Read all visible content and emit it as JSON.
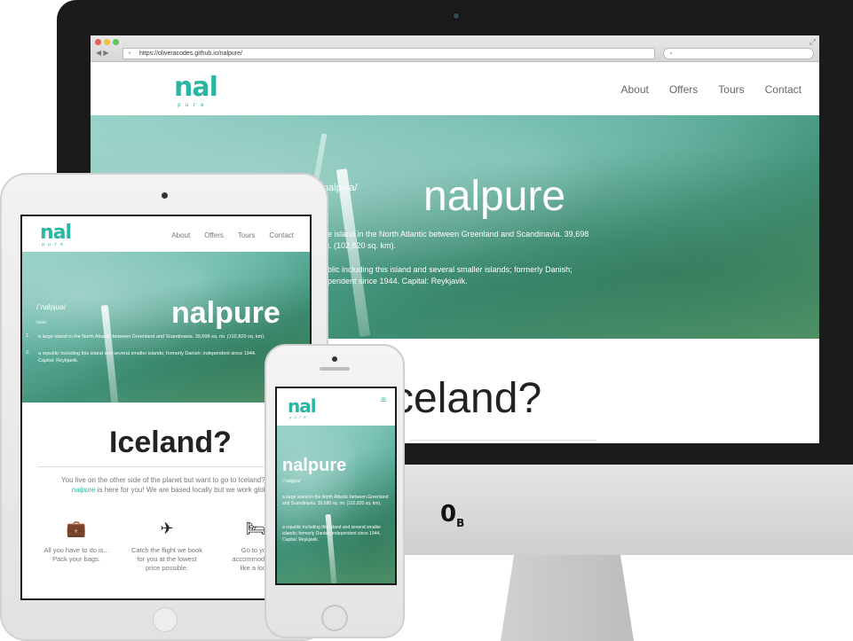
{
  "imac": {
    "browser": {
      "url": "https://oliveracodes.github.io/nalpure/",
      "nav_arrows": "◀ ▶",
      "new_tab": "+",
      "search_icon": "magnifier-icon",
      "expand_icon": "⤢"
    },
    "logo": {
      "main": "nal",
      "sub": "pure"
    },
    "menu": [
      "About",
      "Offers",
      "Tours",
      "Contact"
    ],
    "hero": {
      "pron_fragment": "nalpjua/",
      "title": "nalpure",
      "def1_line1": "ge island in the North Atlantic between Greenland and Scandinavia. 39,698",
      "def1_line2": "ni. (102,820 sq. km).",
      "def2_line1": "ublic including this island and several smaller islands; formerly Danish;",
      "def2_line2": "ependent since 1944. Capital: Reykjavik."
    },
    "below_heading_fragment": "celand?",
    "brand": "0",
    "brand_sub": "B"
  },
  "ipad": {
    "logo": {
      "main": "nal",
      "sub": "pure"
    },
    "menu": [
      "About",
      "Offers",
      "Tours",
      "Contact"
    ],
    "hero": {
      "pron": "/ˈnalpjʊə/",
      "noun": "noun",
      "title": "nalpure",
      "n1": "1.",
      "def1": "a large island in the North Atlantic between Greenland and Scandinavia. 39,698 sq. mi. (102,820 sq. km).",
      "n2": "2.",
      "def2_line1": "a republic including this island and several smaller islands; formerly Danish; independent since 1944.",
      "def2_line2": "Capital: Reykjavik."
    },
    "heading": "Iceland?",
    "paragraph_line1": "You live on the other side of the planet but want to go to Iceland? No pro",
    "paragraph_brand": "nalpure",
    "paragraph_line2": " is here for you! We are based locally but we work globally",
    "features": [
      {
        "icon": "suitcase-icon",
        "glyph": "💼",
        "line1": "All you have to do is...",
        "line2": "Pack your bags."
      },
      {
        "icon": "airplane-icon",
        "glyph": "✈",
        "line1": "Catch the flight we book",
        "line2": "for you at the lowest",
        "line3": "price possible."
      },
      {
        "icon": "bed-icon",
        "glyph": "🛏",
        "line1": "Go to you",
        "line2": "accommodation",
        "line3": "like a local"
      }
    ]
  },
  "iphone": {
    "logo": {
      "main": "nal",
      "sub": "pure"
    },
    "menu_icon": "≡",
    "hero": {
      "title": "nalpure",
      "pron": "/ˈnalpjʊə/",
      "def1": "a large island in the North Atlantic between Greenland and Scandinavia. 39,698 sq. mi. (102,820 sq. km).",
      "def2": "a republic including this island and several smaller islands; formerly Danish; independent since 1944. Capital: Reykjavik."
    }
  },
  "colors": {
    "accent": "#29b6a2",
    "device_dark": "#1b1b1b",
    "device_silver": "#e3e3e3"
  }
}
